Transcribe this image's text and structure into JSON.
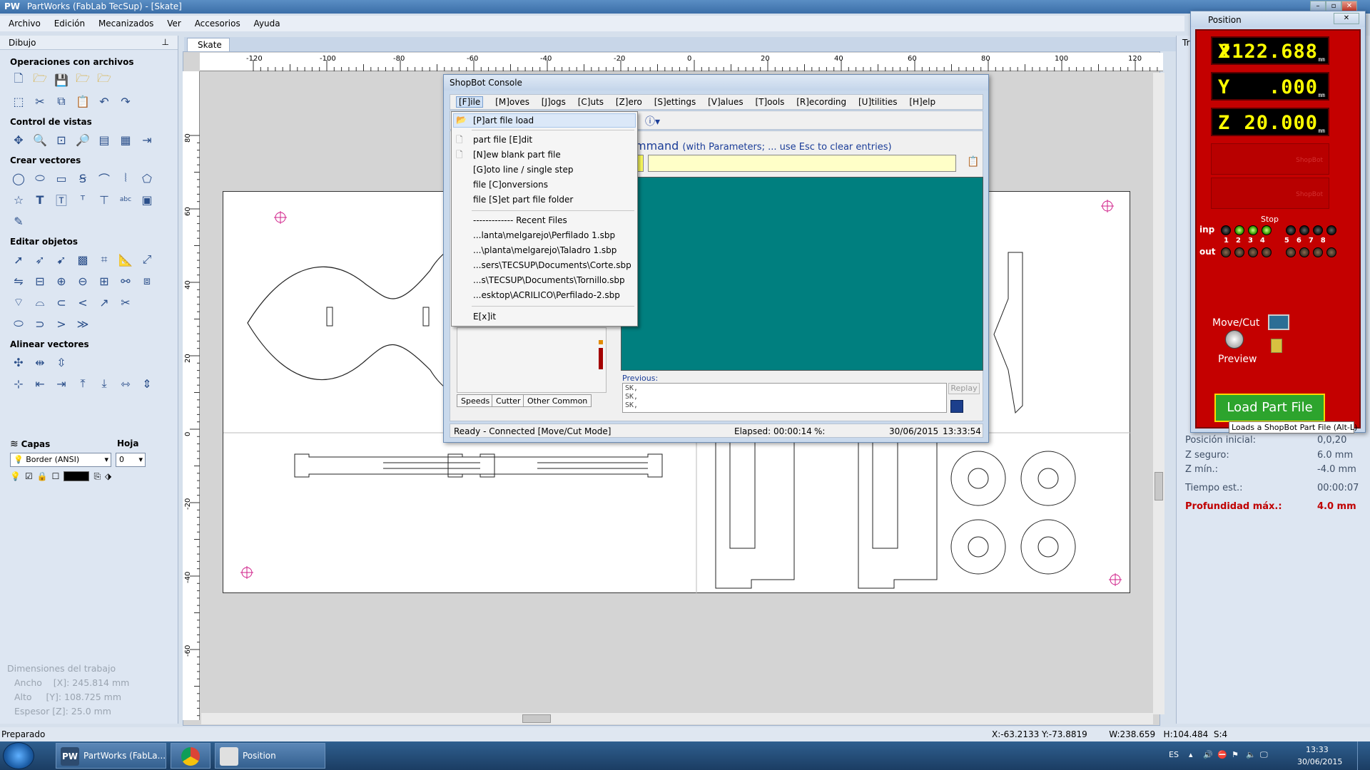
{
  "app": {
    "title": "PartWorks (FabLab TecSup) - [Skate]",
    "logo": "PW"
  },
  "menu": [
    "Archivo",
    "Edición",
    "Mecanizados",
    "Ver",
    "Accesorios",
    "Ayuda"
  ],
  "left_panel": {
    "header": "Dibujo",
    "sections": {
      "file_ops": "Operaciones con archivos",
      "view_ctrl": "Control de vistas",
      "create_vectors": "Crear vectores",
      "edit_objects": "Editar objetos",
      "align_vectors": "Alinear vectores"
    },
    "layers": {
      "label": "Capas",
      "sheet_label": "Hoja",
      "layer_value": "Border (ANSI)",
      "sheet_value": "0"
    },
    "dimensions": {
      "title": "Dimensiones del trabajo",
      "width": "Ancho    [X]: 245.814 mm",
      "height": "Alto     [Y]: 108.725 mm",
      "thickness": "Espesor [Z]: 25.0 mm"
    }
  },
  "doc_tab": "Skate",
  "ruler_h_labels": [
    "-120",
    "-100",
    "-80",
    "-60",
    "-40",
    "-20",
    "0",
    "20",
    "40",
    "60",
    "80",
    "100",
    "120"
  ],
  "ruler_v_labels": [
    "80",
    "60",
    "40",
    "20",
    "0",
    "-20",
    "-40",
    "-60"
  ],
  "status": {
    "left": "Preparado",
    "coords": "X:-63.2133 Y:-73.8819        W:238.659   H:104.484  S:4"
  },
  "right_panel": {
    "header_partial": "Tra",
    "rows": [
      {
        "label": "Posición inicial:",
        "value": "0,0,20"
      },
      {
        "label": "Z seguro:",
        "value": "6.0 mm"
      },
      {
        "label": "Z mín.:",
        "value": "-4.0 mm"
      },
      {
        "label": "Tiempo est.:",
        "value": "00:00:07"
      }
    ],
    "max_depth": {
      "label": "Profundidad máx.:",
      "value": "4.0 mm"
    }
  },
  "shopbot_console": {
    "title": "ShopBot  Console",
    "menu": [
      "[F]ile",
      "[M]oves",
      "[J]ogs",
      "[C]uts",
      "[Z]ero",
      "[S]ettings",
      "[V]alues",
      "[T]ools",
      "[R]ecording",
      "[U]tilities",
      "[H]elp"
    ],
    "command_label": "mmand",
    "command_hint": "(with Parameters;  ... use Esc to clear entries)",
    "previous_label": "Previous:",
    "previous_lines": [
      "SK,",
      "SK,",
      "SK,"
    ],
    "replay": "Replay",
    "tabs": [
      "Speeds",
      "Cutter",
      "Other Common"
    ],
    "status_left": "Ready - Connected  [Move/Cut Mode]",
    "elapsed": "Elapsed: 00:00:14",
    "percent": "%:",
    "date": "30/06/2015",
    "time": "13:33:54",
    "file_menu": {
      "items": [
        "[P]art file load",
        "part file [E]dit",
        "[N]ew blank part file",
        "[G]oto line / single step",
        "file [C]onversions",
        "file [S]et part file folder"
      ],
      "recent_header": "------------- Recent Files",
      "recent": [
        "...lanta\\melgarejo\\Perfilado 1.sbp",
        "...\\planta\\melgarejo\\Taladro 1.sbp",
        "...sers\\TECSUP\\Documents\\Corte.sbp",
        "...s\\TECSUP\\Documents\\Tornillo.sbp",
        "...esktop\\ACRILICO\\Perfilado-2.sbp"
      ],
      "exit": "E[x]it"
    }
  },
  "position_window": {
    "title": "Position",
    "x_axis": "X",
    "x_value": "2122.688",
    "y_axis": "Y",
    "y_value": ".000",
    "z_axis": "Z",
    "z_value": "20.000",
    "unit": "mm",
    "ghost_label": "ShopBot",
    "stop": "Stop",
    "inp": "inp",
    "out": "out",
    "io_numbers": [
      "1",
      "2",
      "3",
      "4",
      "5",
      "6",
      "7",
      "8"
    ],
    "move_cut": "Move/Cut",
    "preview": "Preview",
    "load_button": "Load Part File",
    "tooltip": "Loads a ShopBot Part File (Alt-L)"
  },
  "taskbar": {
    "items": [
      "PartWorks (FabLa...",
      "",
      "Position"
    ],
    "lang": "ES",
    "clock_time": "13:33",
    "clock_date": "30/06/2015"
  }
}
